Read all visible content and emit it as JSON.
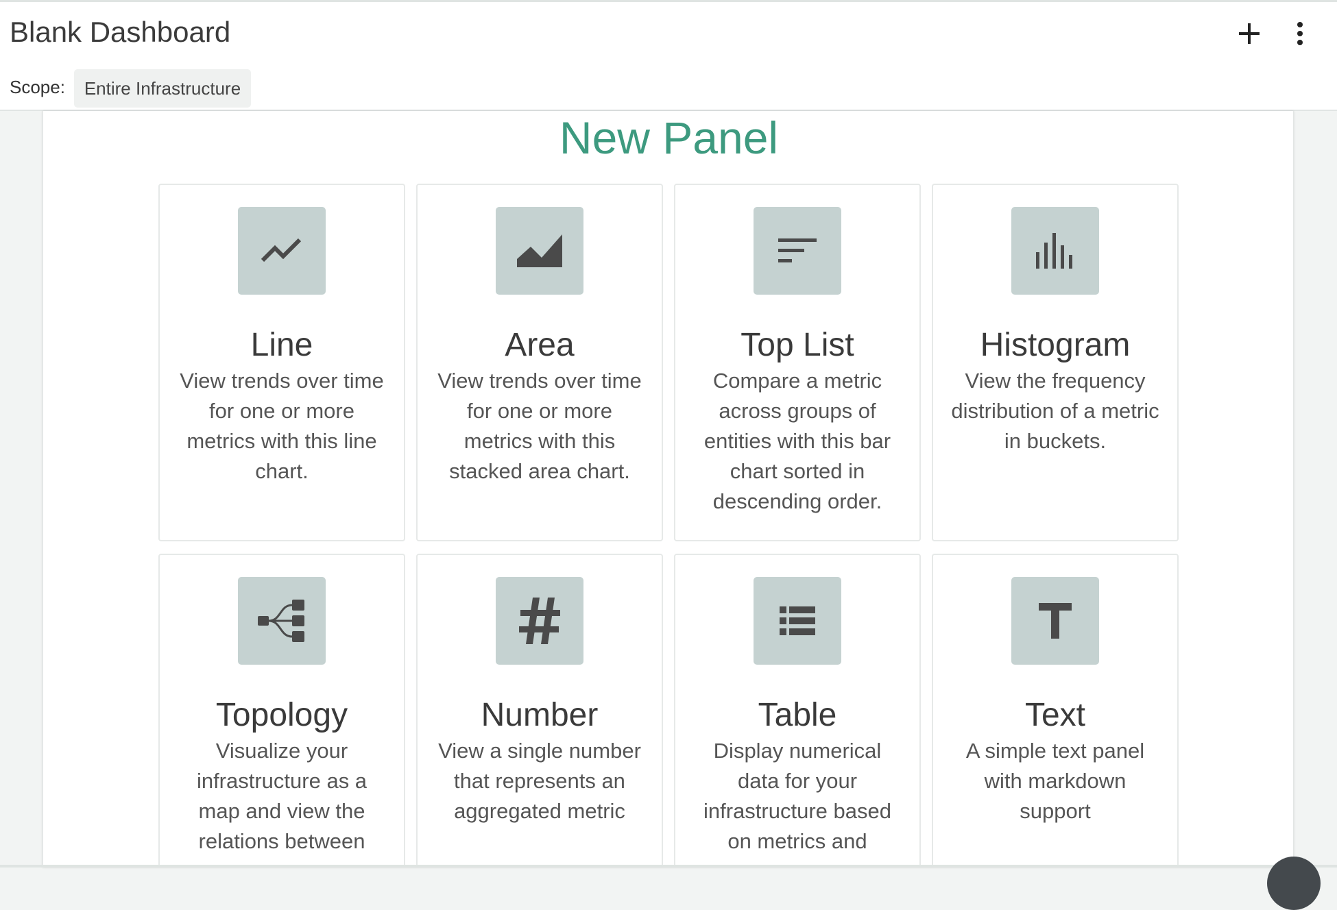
{
  "header": {
    "title": "Blank Dashboard",
    "scope_label": "Scope:",
    "scope_value": "Entire Infrastructure",
    "add_icon": "plus-icon",
    "menu_icon": "vertical-dots-icon"
  },
  "panel": {
    "title": "New Panel",
    "accent_color": "#3d9a7f",
    "icon_bg_color": "#c5d2d1",
    "cards": [
      {
        "title": "Line",
        "icon": "line-chart-icon",
        "description": "View trends over time for one or more metrics with this line chart."
      },
      {
        "title": "Area",
        "icon": "area-chart-icon",
        "description": "View trends over time for one or more metrics with this stacked area chart."
      },
      {
        "title": "Top List",
        "icon": "sort-list-icon",
        "description": "Compare a metric across groups of entities with this bar chart sorted in descending order."
      },
      {
        "title": "Histogram",
        "icon": "histogram-icon",
        "description": "View the frequency distribution of a metric in buckets."
      },
      {
        "title": "Topology",
        "icon": "topology-icon",
        "description": "Visualize your infrastructure as a map and view the relations between"
      },
      {
        "title": "Number",
        "icon": "hash-icon",
        "description": "View a single number that represents an aggregated metric"
      },
      {
        "title": "Table",
        "icon": "table-list-icon",
        "description": "Display numerical data for your infrastructure based on metrics and"
      },
      {
        "title": "Text",
        "icon": "text-t-icon",
        "description": "A simple text panel with markdown support"
      }
    ]
  }
}
